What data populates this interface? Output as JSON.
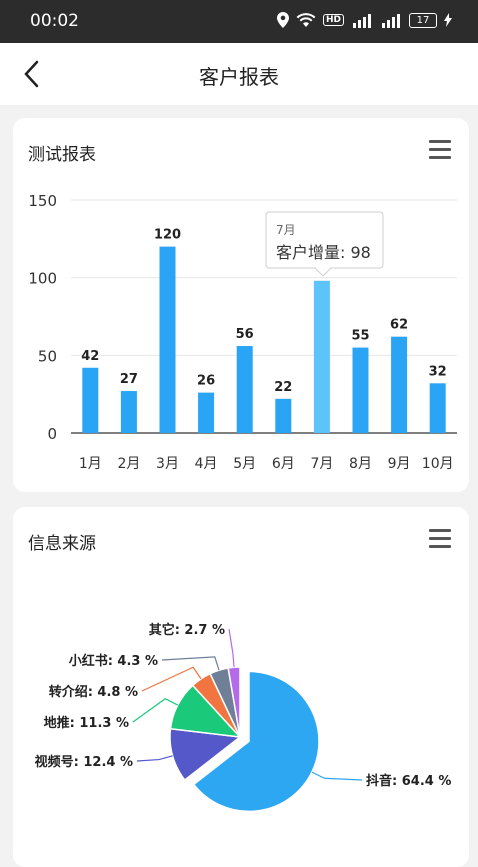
{
  "status_bar": {
    "time": "00:02",
    "hd_label": "HD",
    "battery": "17"
  },
  "header": {
    "title": "客户报表"
  },
  "bar_card": {
    "title": "测试报表"
  },
  "pie_card": {
    "title": "信息来源"
  },
  "tooltip": {
    "category": "7月",
    "label": "客户增量: 98"
  },
  "colors": {
    "bar": "#2aa4f4",
    "bar_highlight": "#5cc4fb"
  },
  "chart_data": [
    {
      "type": "bar",
      "title": "测试报表",
      "categories": [
        "1月",
        "2月",
        "3月",
        "4月",
        "5月",
        "6月",
        "7月",
        "8月",
        "9月",
        "10月"
      ],
      "series": [
        {
          "name": "客户增量",
          "values": [
            42,
            27,
            120,
            26,
            56,
            22,
            98,
            55,
            62,
            32
          ]
        }
      ],
      "ylim": [
        0,
        150
      ],
      "yticks": [
        0,
        50,
        100,
        150
      ],
      "grid": true,
      "highlight_index": 6
    },
    {
      "type": "pie",
      "title": "信息来源",
      "slices": [
        {
          "name": "抖音",
          "value": 64.4,
          "label": "抖音: 64.4 %",
          "color": "#2ea7f3"
        },
        {
          "name": "视频号",
          "value": 12.4,
          "label": "视频号: 12.4 %",
          "color": "#5458c9"
        },
        {
          "name": "地推",
          "value": 11.3,
          "label": "地推: 11.3 %",
          "color": "#1bc97a"
        },
        {
          "name": "转介绍",
          "value": 4.8,
          "label": "转介绍: 4.8 %",
          "color": "#f07540"
        },
        {
          "name": "小红书",
          "value": 4.3,
          "label": "小红书: 4.3 %",
          "color": "#6e7f97"
        },
        {
          "name": "其它",
          "value": 2.7,
          "label": "其它: 2.7 %",
          "color": "#b46bea"
        }
      ]
    }
  ]
}
